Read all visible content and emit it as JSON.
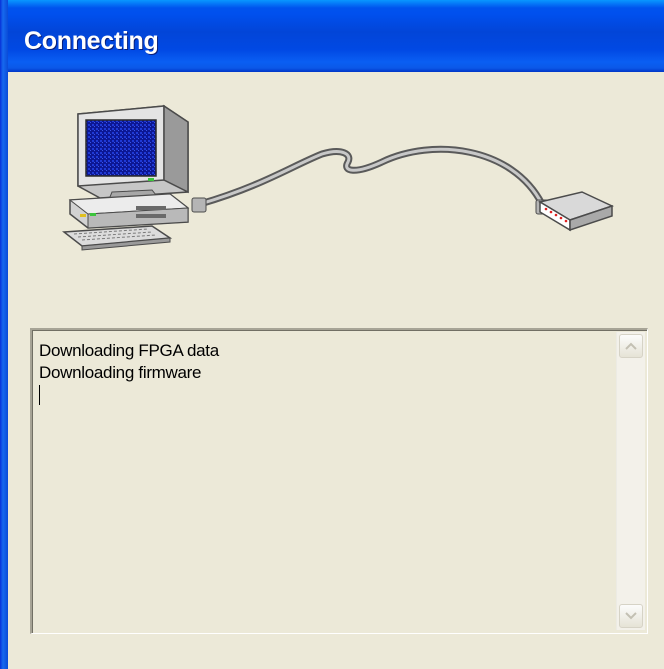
{
  "window": {
    "title": "Connecting"
  },
  "illustration": {
    "computer_icon": "desktop-computer-icon",
    "cable_icon": "serial-cable-icon",
    "device_icon": "hardware-device-icon"
  },
  "log": {
    "lines": [
      "Downloading FPGA data",
      "Downloading firmware"
    ]
  },
  "scrollbar": {
    "up_icon": "scroll-up-arrow-icon",
    "down_icon": "scroll-down-arrow-icon"
  },
  "colors": {
    "titlebar": "#0053ee",
    "window_face": "#ece9d8",
    "title_text": "#ffffff",
    "monitor_screen": "#101a9e"
  }
}
